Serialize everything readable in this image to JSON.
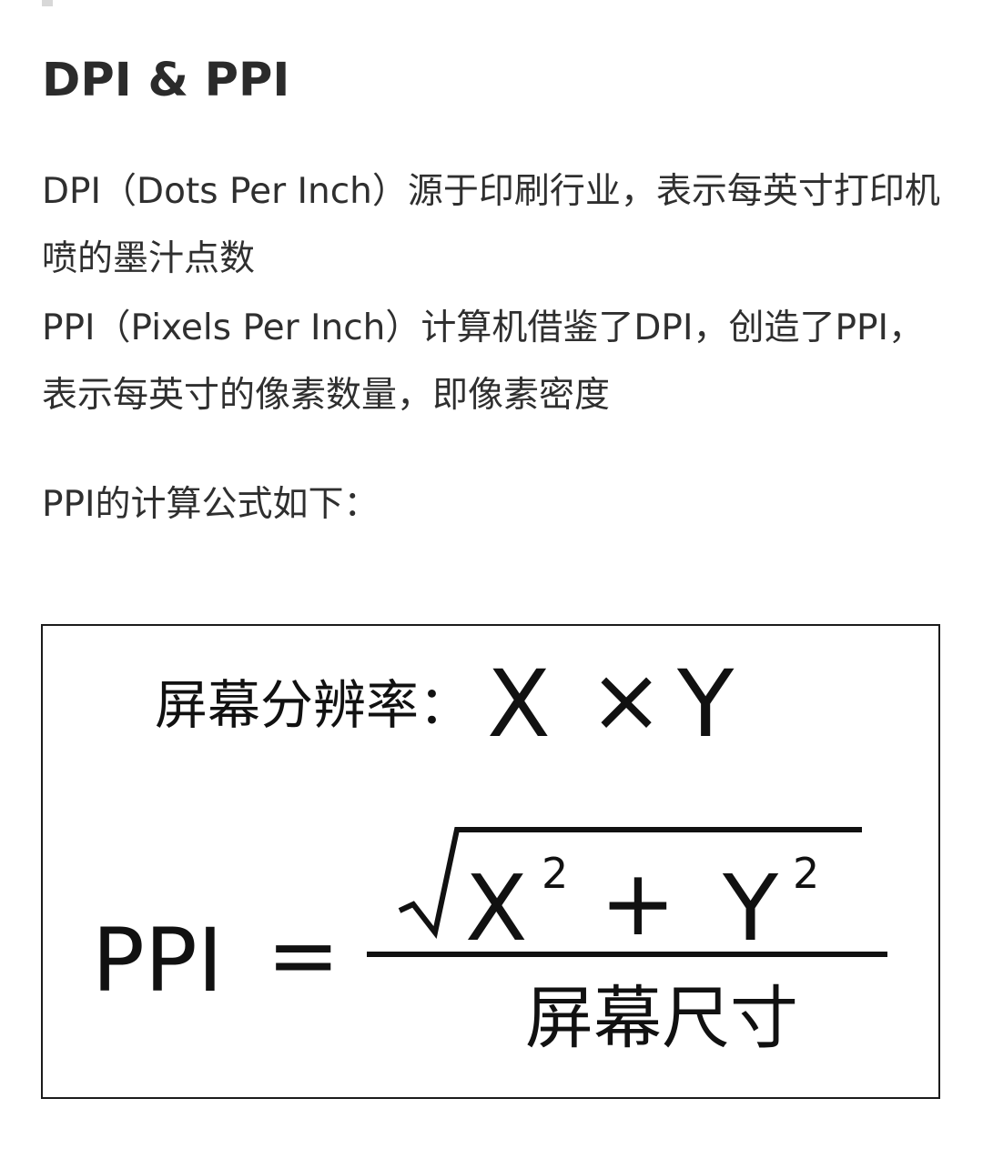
{
  "title": "DPI & PPI",
  "paragraphs": {
    "dpi": "DPI（Dots Per Inch）源于印刷行业，表示每英寸打印机喷的墨汁点数",
    "ppi": "PPI（Pixels Per Inch）计算机借鉴了DPI，创造了PPI，表示每英寸的像素数量，即像素密度",
    "formula_intro": "PPI的计算公式如下："
  },
  "formula": {
    "resolution_label": "屏幕分辨率：",
    "resolution_x": "X",
    "times": "×",
    "resolution_y": "Y",
    "lhs": "PPI",
    "equals": "=",
    "numerator_x": "X",
    "numerator_x_exp": "2",
    "plus": "+",
    "numerator_y": "Y",
    "numerator_y_exp": "2",
    "denominator": "屏幕尺寸"
  }
}
